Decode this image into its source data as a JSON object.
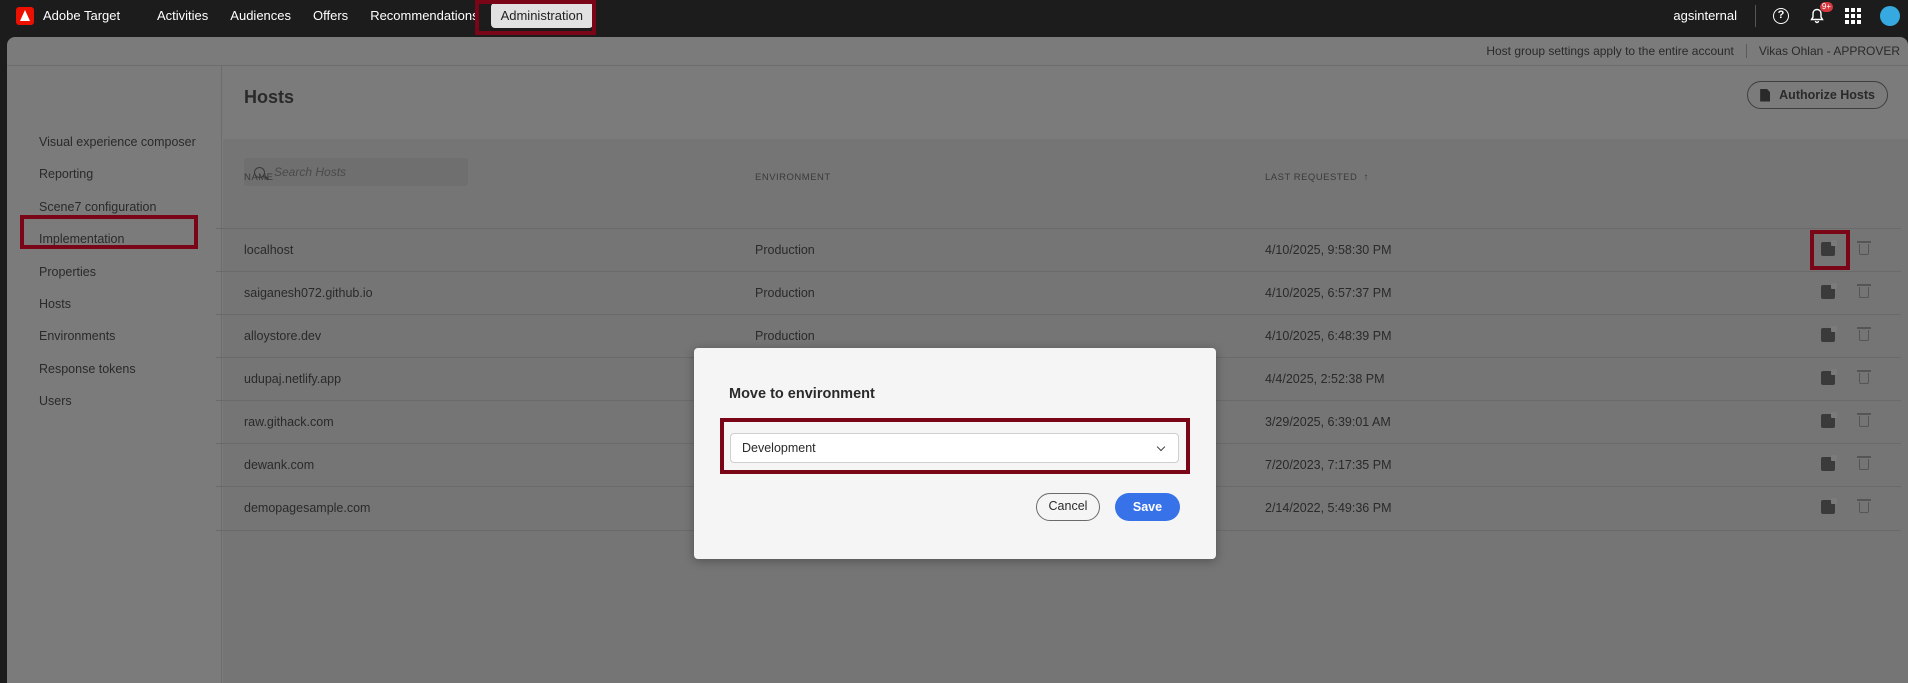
{
  "app": {
    "brand": "Adobe Target"
  },
  "nav": {
    "items": [
      "Activities",
      "Audiences",
      "Offers",
      "Recommendations",
      "Administration"
    ],
    "active": "Administration"
  },
  "topbar": {
    "org": "agsinternal",
    "notification_badge": "9+"
  },
  "subheader": {
    "notice": "Host group settings apply to the entire account",
    "user": "Vikas Ohlan - APPROVER"
  },
  "sidebar": {
    "items": [
      "Visual experience composer",
      "Reporting",
      "Scene7 configuration",
      "Implementation",
      "Properties",
      "Hosts",
      "Environments",
      "Response tokens",
      "Users"
    ],
    "active": "Hosts"
  },
  "page": {
    "title": "Hosts",
    "authorize_label": "Authorize Hosts",
    "search_placeholder": "Search Hosts"
  },
  "table": {
    "columns": [
      "NAME",
      "ENVIRONMENT",
      "LAST REQUESTED"
    ],
    "sort_indicator": "↑",
    "rows": [
      {
        "name": "localhost",
        "environment": "Production",
        "last_requested": "4/10/2025, 9:58:30 PM"
      },
      {
        "name": "saiganesh072.github.io",
        "environment": "Production",
        "last_requested": "4/10/2025, 6:57:37 PM"
      },
      {
        "name": "alloystore.dev",
        "environment": "Production",
        "last_requested": "4/10/2025, 6:48:39 PM"
      },
      {
        "name": "udupaj.netlify.app",
        "environment": "",
        "last_requested": "4/4/2025, 2:52:38 PM"
      },
      {
        "name": "raw.githack.com",
        "environment": "",
        "last_requested": "3/29/2025, 6:39:01 AM"
      },
      {
        "name": "dewank.com",
        "environment": "",
        "last_requested": "7/20/2023, 7:17:35 PM"
      },
      {
        "name": "demopagesample.com",
        "environment": "",
        "last_requested": "2/14/2022, 5:49:36 PM"
      }
    ]
  },
  "modal": {
    "title": "Move to environment",
    "selected": "Development",
    "cancel_label": "Cancel",
    "save_label": "Save"
  },
  "colors": {
    "highlight": "#7a0517",
    "primary_button": "#3772e8",
    "brand_red": "#eb1000"
  }
}
